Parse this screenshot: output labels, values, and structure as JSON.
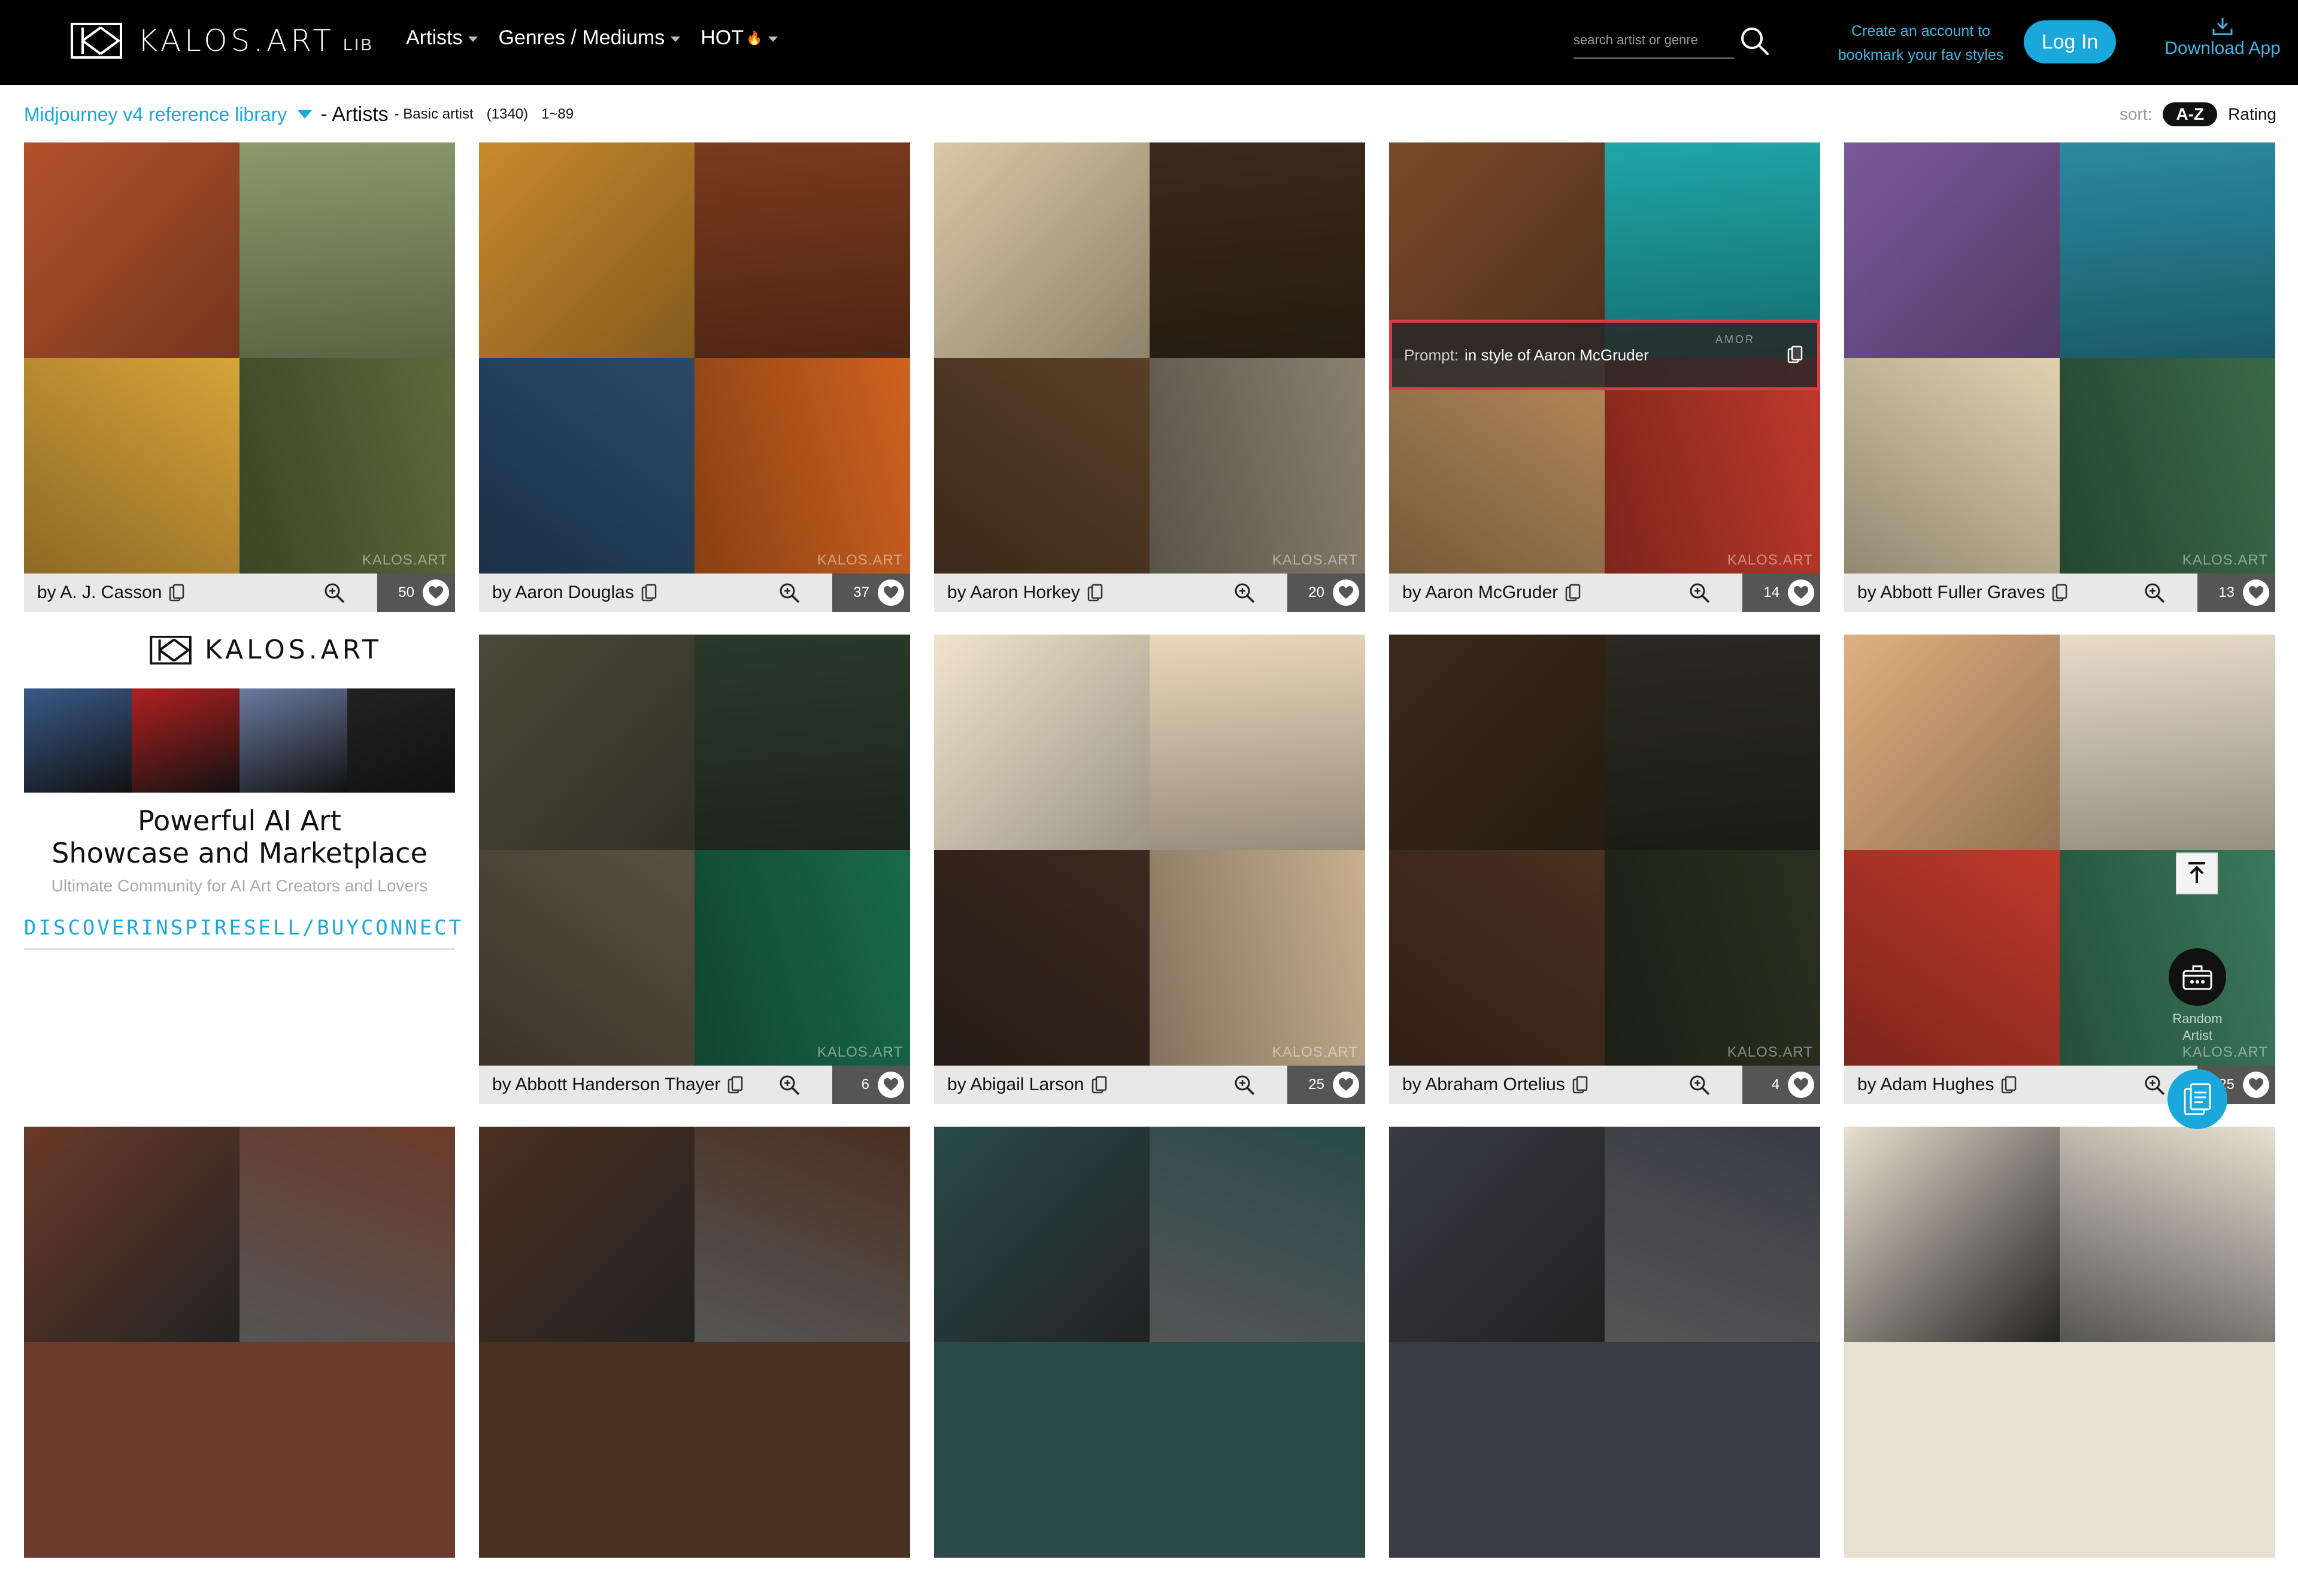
{
  "header": {
    "brand": "KALOS.ART",
    "brand_suffix": "LIB",
    "nav": [
      {
        "label": "Artists"
      },
      {
        "label": "Genres / Mediums"
      },
      {
        "label": "HOT"
      }
    ],
    "search_placeholder": "search artist or genre",
    "promo_line1": "Create an account to",
    "promo_line2": "bookmark your fav styles",
    "login_label": "Log In",
    "download_label": "Download App"
  },
  "subbar": {
    "library": "Midjourney v4 reference library",
    "section": "- Artists",
    "subsection": "- Basic artist",
    "count": "(1340)",
    "range": "1~89",
    "sort_label": "sort:",
    "sort_options": [
      "A-Z",
      "Rating"
    ]
  },
  "cards": [
    {
      "name": "by A. J. Casson",
      "likes": "50",
      "colors": [
        "#b3522c",
        "#8a9a6a",
        "#d8a339",
        "#5c6a3a"
      ]
    },
    {
      "name": "by Aaron Douglas",
      "likes": "37",
      "colors": [
        "#c98a2d",
        "#7a3a1e",
        "#2a4a6a",
        "#d0621f"
      ]
    },
    {
      "name": "by Aaron Horkey",
      "likes": "20",
      "colors": [
        "#d9c9a5",
        "#3a2a1a",
        "#5a4028",
        "#8a8070"
      ]
    },
    {
      "name": "by Aaron McGruder",
      "likes": "14",
      "colors": [
        "#7a4a2a",
        "#1fa6a8",
        "#b58a5a",
        "#c0392b"
      ],
      "prompt_label": "Prompt:",
      "prompt_text": "in style of Aaron McGruder",
      "watermark": "AMOR"
    },
    {
      "name": "by Abbott Fuller Graves",
      "likes": "13",
      "colors": [
        "#7a5a9a",
        "#2a8aa0",
        "#e0d2b0",
        "#3a6a4a"
      ]
    },
    {
      "name": "by Abbott Handerson Thayer",
      "likes": "6",
      "colors": [
        "#4a4a3a",
        "#2a3a2a",
        "#5a5040",
        "#1a6a4a"
      ]
    },
    {
      "name": "by Abigail Larson",
      "likes": "25",
      "colors": [
        "#f0e4cc",
        "#e8d8bc",
        "#3a2a20",
        "#c8b090"
      ]
    },
    {
      "name": "by Abraham Ortelius",
      "likes": "4",
      "colors": [
        "#3a2a1a",
        "#2a2a22",
        "#4a3020",
        "#2a3020"
      ]
    },
    {
      "name": "by Adam Hughes",
      "likes": "25",
      "colors": [
        "#e0b080",
        "#e8dcc8",
        "#c0392b",
        "#3a7a5a"
      ]
    }
  ],
  "bottom_row_colors": [
    "#6a3a2a",
    "#4a3020",
    "#2a4a4a",
    "#3a3a44",
    "#e8e0d0"
  ],
  "card_watermark": "KALOS.ART",
  "ad": {
    "brand": "KALOS.ART",
    "headline1": "Powerful AI Art",
    "headline2": "Showcase and Marketplace",
    "subline": "Ultimate Community for AI Art Creators and Lovers",
    "links": [
      "DISCOVER",
      "INSPIRE",
      "SELL/BUY",
      "CONNECT"
    ],
    "strip_colors": [
      "#3a5a8a",
      "#b02020",
      "#6a7aa0",
      "#222222"
    ]
  },
  "floating": {
    "random_label1": "Random",
    "random_label2": "Artist"
  }
}
